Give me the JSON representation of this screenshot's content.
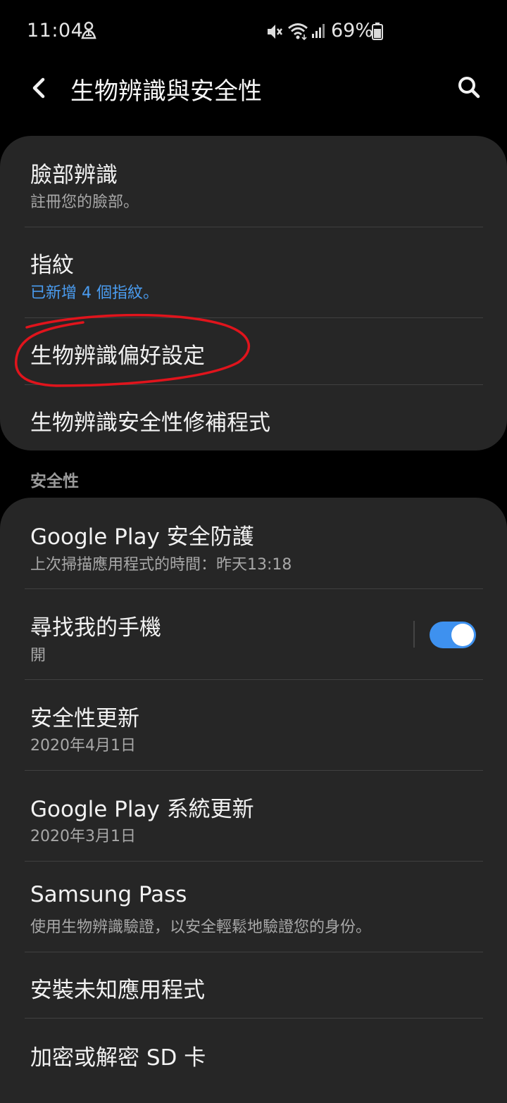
{
  "status_bar": {
    "time": "11:04",
    "battery": "69%",
    "icons": [
      "person-notification-icon",
      "mute-icon",
      "wifi-icon",
      "cell-signal-icon",
      "battery-icon"
    ]
  },
  "app_bar": {
    "title": "生物辨識與安全性",
    "back_icon": "chevron-left-icon",
    "search_icon": "search-icon"
  },
  "biometrics": {
    "items": [
      {
        "title": "臉部辨識",
        "subtitle": "註冊您的臉部。"
      },
      {
        "title": "指紋",
        "subtitle": "已新增 4 個指紋。"
      },
      {
        "title": "生物辨識偏好設定"
      },
      {
        "title": "生物辨識安全性修補程式"
      }
    ]
  },
  "security": {
    "header": "安全性",
    "items": [
      {
        "title": "Google Play 安全防護",
        "subtitle": "上次掃描應用程式的時間：昨天13:18"
      },
      {
        "title": "尋找我的手機",
        "subtitle": "開",
        "toggle_on": true
      },
      {
        "title": "安全性更新",
        "subtitle": "2020年4月1日"
      },
      {
        "title": "Google Play 系統更新",
        "subtitle": "2020年3月1日"
      },
      {
        "title": "Samsung Pass",
        "subtitle": "使用生物辨識驗證，以安全輕鬆地驗證您的身份。"
      },
      {
        "title": "安裝未知應用程式"
      },
      {
        "title": "加密或解密 SD 卡"
      }
    ]
  },
  "colors": {
    "background": "#000000",
    "card": "#262626",
    "accent": "#4a9cf0",
    "toggle": "#3e91ef",
    "annotation": "#e0141c"
  }
}
